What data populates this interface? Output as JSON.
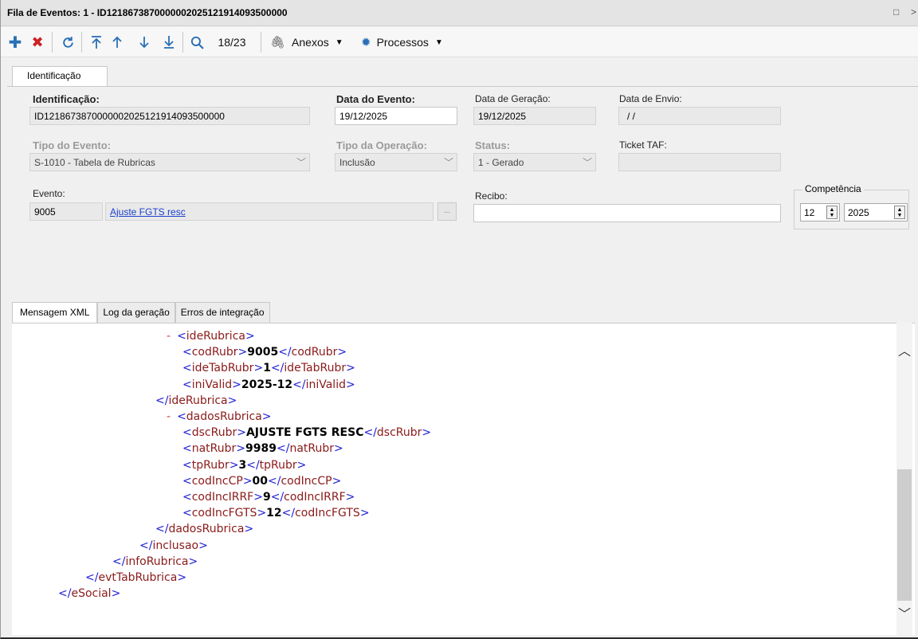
{
  "window": {
    "title": "Fila de Eventos: 1 - ID1218673870000002025121914093500000",
    "maximize_glyph": "□",
    "close_glyph": ">"
  },
  "toolbar": {
    "record_counter": "18/23",
    "attachments_label": "Anexos",
    "processes_label": "Processos"
  },
  "tabs_top": {
    "identificacao": "Identificação"
  },
  "form": {
    "identificacao": {
      "label": "Identificação:",
      "value": "ID1218673870000002025121914093500000"
    },
    "data_evento": {
      "label": "Data do Evento:",
      "value": "19/12/2025"
    },
    "data_geracao": {
      "label": "Data de Geração:",
      "value": "19/12/2025"
    },
    "data_envio": {
      "label": "Data de Envio:",
      "value": " / /"
    },
    "tipo_evento": {
      "label": "Tipo do Evento:",
      "value": "S-1010 - Tabela de Rubricas"
    },
    "tipo_operacao": {
      "label": "Tipo da Operação:",
      "value": "Inclusão"
    },
    "status": {
      "label": "Status:",
      "value": "1 - Gerado"
    },
    "ticket_taf": {
      "label": "Ticket TAF:",
      "value": ""
    },
    "evento": {
      "label": "Evento:",
      "code": "9005",
      "description": "Ajuste FGTS resc",
      "browse": "..."
    },
    "recibo": {
      "label": "Recibo:",
      "value": ""
    },
    "competencia": {
      "label": "Competência",
      "month": "12",
      "year": "2025"
    }
  },
  "tabs_bottom": [
    "Mensagem XML",
    "Log da geração",
    "Erros de integração"
  ],
  "xml": {
    "lines": [
      {
        "indent": 1,
        "minus": "-",
        "open": "ideRubrica"
      },
      {
        "indent": 2,
        "tag": "codRubr",
        "value": "9005"
      },
      {
        "indent": 2,
        "tag": "ideTabRubr",
        "value": "1"
      },
      {
        "indent": 2,
        "tag": "iniValid",
        "value": "2025-12"
      },
      {
        "indent": 1,
        "close": "ideRubrica"
      },
      {
        "indent": 1,
        "minus": "-",
        "open": "dadosRubrica"
      },
      {
        "indent": 2,
        "tag": "dscRubr",
        "value": "AJUSTE FGTS RESC"
      },
      {
        "indent": 2,
        "tag": "natRubr",
        "value": "9989"
      },
      {
        "indent": 2,
        "tag": "tpRubr",
        "value": "3"
      },
      {
        "indent": 2,
        "tag": "codIncCP",
        "value": "00"
      },
      {
        "indent": 2,
        "tag": "codIncIRRF",
        "value": "9"
      },
      {
        "indent": 2,
        "tag": "codIncFGTS",
        "value": "12"
      },
      {
        "indent": 1,
        "close": "dadosRubrica"
      },
      {
        "indent": 0,
        "close": "inclusao"
      },
      {
        "indent": -1,
        "close": "infoRubrica"
      },
      {
        "indent": -2,
        "close": "evtTabRubrica"
      },
      {
        "indent": -3,
        "close": "eSocial"
      }
    ]
  },
  "icons": {
    "add": "plus-icon",
    "delete": "delete-icon",
    "refresh": "refresh-icon",
    "first": "first-record-icon",
    "prev": "prev-record-icon",
    "next": "next-record-icon",
    "last": "last-record-icon",
    "search": "search-icon",
    "attach": "paperclip-icon",
    "process": "gear-icon"
  }
}
